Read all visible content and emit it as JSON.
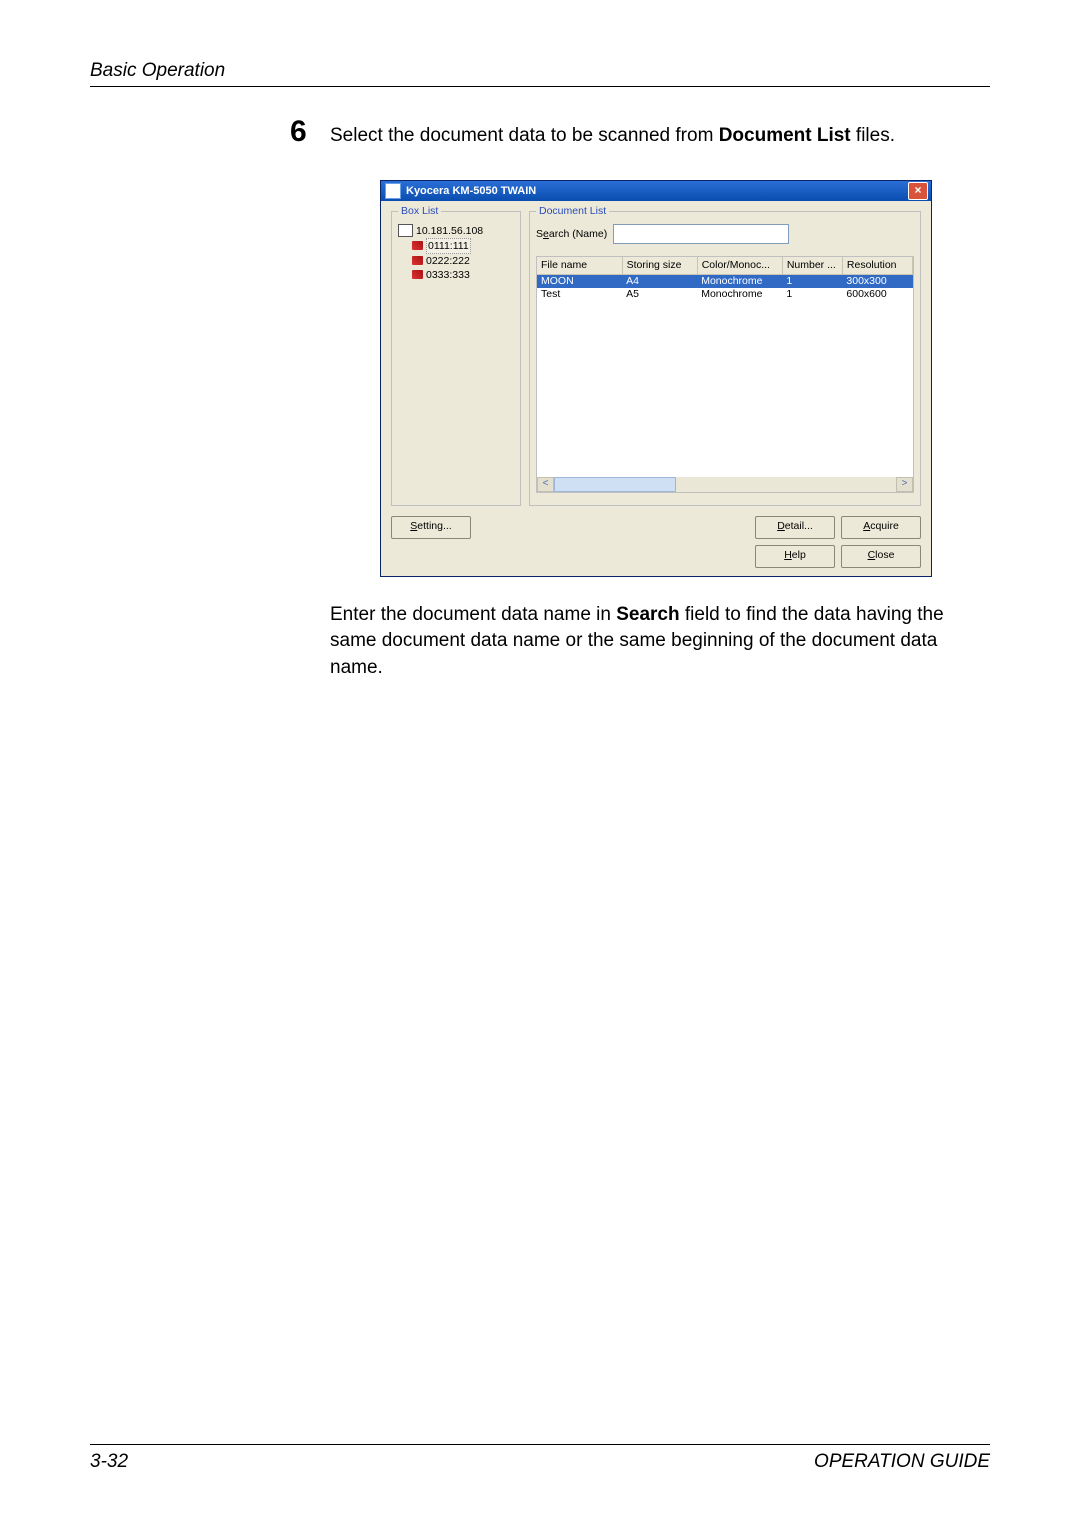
{
  "header": {
    "section": "Basic Operation"
  },
  "step": {
    "number": "6",
    "text_before": "Select the document data to be scanned from ",
    "bold": "Document List",
    "text_after": " files."
  },
  "dialog": {
    "title": "Kyocera KM-5050 TWAIN",
    "box_list": {
      "legend": "Box List",
      "root": "10.181.56.108",
      "items": [
        "0111:111",
        "0222:222",
        "0333:333"
      ],
      "selected_index": 0
    },
    "document_list": {
      "legend": "Document List",
      "search_label_pre": "S",
      "search_label_u": "e",
      "search_label_post": "arch (Name)",
      "columns": [
        "File name",
        "Storing size",
        "Color/Monoc...",
        "Number ...",
        "Resolution"
      ],
      "rows": [
        {
          "cells": [
            "MOON",
            "A4",
            "Monochrome",
            "1",
            "300x300"
          ],
          "selected": true
        },
        {
          "cells": [
            "Test",
            "A5",
            "Monochrome",
            "1",
            "600x600"
          ],
          "selected": false
        }
      ]
    },
    "buttons": {
      "setting_u": "S",
      "setting_rest": "etting...",
      "detail_u": "D",
      "detail_rest": "etail...",
      "acquire_u": "A",
      "acquire_rest": "cquire",
      "help_u": "H",
      "help_rest": "elp",
      "close_u": "C",
      "close_rest": "lose"
    }
  },
  "after": {
    "t1": "Enter the document data name in ",
    "b1": "Search",
    "t2": " field to find the data having the same document data name or the same beginning of the document data name."
  },
  "footer": {
    "page": "3-32",
    "guide": "OPERATION GUIDE"
  }
}
